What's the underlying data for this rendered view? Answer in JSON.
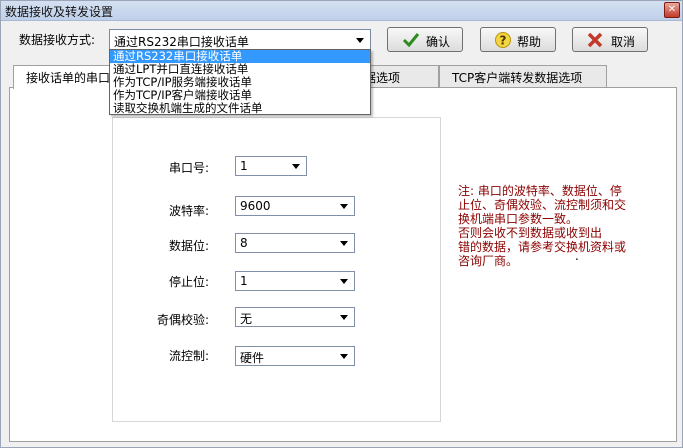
{
  "window": {
    "title": "数据接收及转发设置",
    "close_glyph": "✕"
  },
  "receive_mode": {
    "label": "数据接收方式:",
    "selected": "通过RS232串口接收话单",
    "options": [
      "通过RS232串口接收话单",
      "通过LPT并口直连接收话单",
      "作为TCP/IP服务端接收话单",
      "作为TCP/IP客户端接收话单",
      "读取交换机端生成的文件话单"
    ]
  },
  "buttons": {
    "ok": "确认",
    "help": "帮助",
    "cancel": "取消"
  },
  "tabs": [
    "接收话单的串口",
    "据选项",
    "TCP客户端转发数据选项"
  ],
  "serial": {
    "port_label": "串口号:",
    "port_value": "1",
    "baud_label": "波特率:",
    "baud_value": "9600",
    "databits_label": "数据位:",
    "databits_value": "8",
    "stopbits_label": "停止位:",
    "stopbits_value": "1",
    "parity_label": "奇偶校验:",
    "parity_value": "无",
    "flow_label": "流控制:",
    "flow_value": "硬件"
  },
  "note": {
    "lines": [
      "注: 串口的波特率、数据位、停",
      "止位、奇偶效验、流控制须和交",
      "换机端串口参数一致。",
      "    否则会收不到数据或收到出",
      "错的数据，请参考交换机资料或",
      "咨询厂商。"
    ],
    "dot": "."
  },
  "colors": {
    "note": "#8b0000",
    "selection": "#3399ff",
    "ok_check": "#2e8b1f",
    "help_q": "#c8a000",
    "cancel_x": "#c0392b"
  }
}
